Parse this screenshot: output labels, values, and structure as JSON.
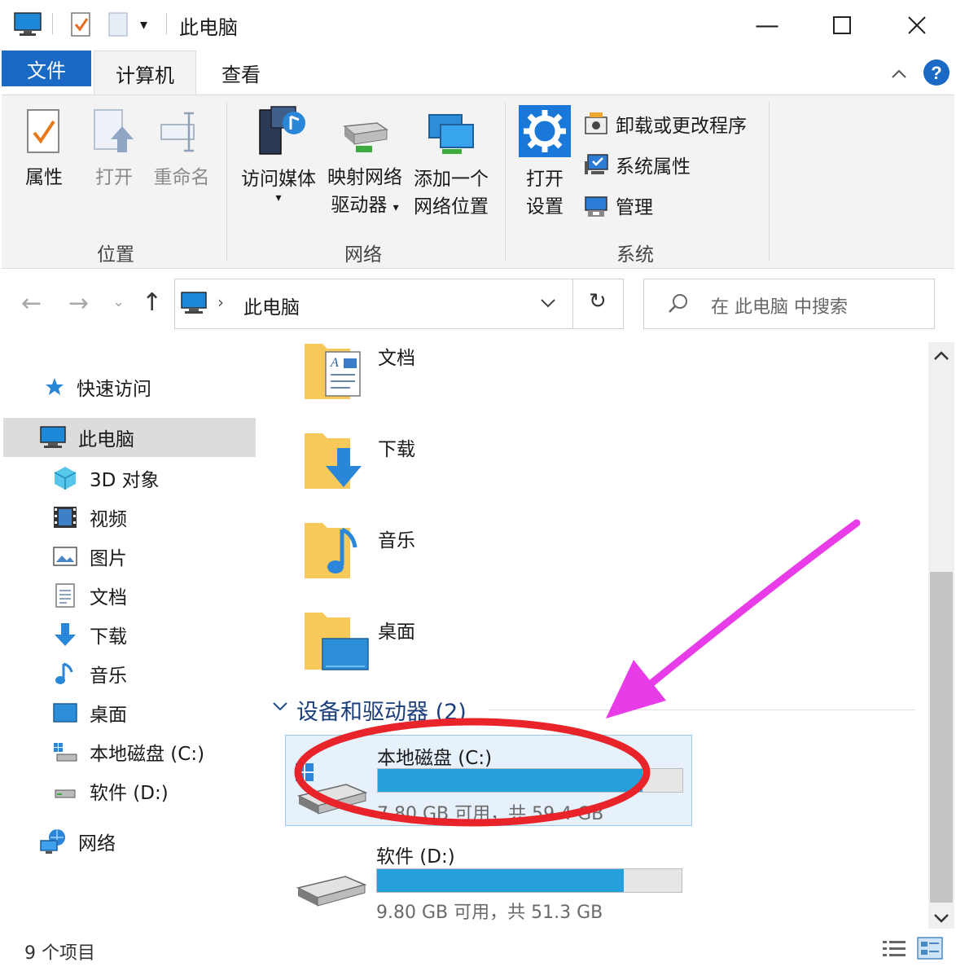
{
  "window": {
    "title": "此电脑"
  },
  "tabs": {
    "file": "文件",
    "computer": "计算机",
    "view": "查看"
  },
  "ribbon": {
    "location": {
      "label": "位置",
      "properties": "属性",
      "open": "打开",
      "rename": "重命名"
    },
    "network": {
      "label": "网络",
      "media_1": "访问媒体",
      "map_1": "映射网络",
      "map_2": "驱动器",
      "add_1": "添加一个",
      "add_2": "网络位置"
    },
    "system": {
      "label": "系统",
      "open_1": "打开",
      "open_2": "设置",
      "uninstall": "卸载或更改程序",
      "sysprops": "系统属性",
      "manage": "管理"
    }
  },
  "address": {
    "path": "此电脑",
    "search_placeholder": "在 此电脑 中搜索"
  },
  "nav": {
    "quick": "快速访问",
    "thispc": "此电脑",
    "items": [
      "3D 对象",
      "视频",
      "图片",
      "文档",
      "下载",
      "音乐",
      "桌面",
      "本地磁盘 (C:)",
      "软件 (D:)"
    ],
    "network": "网络"
  },
  "folders": [
    "文档",
    "下载",
    "音乐",
    "桌面"
  ],
  "devices": {
    "header": "设备和驱动器 (2)",
    "drives": [
      {
        "name": "本地磁盘 (C:)",
        "info": "7.80 GB 可用，共 59.4 GB",
        "used_fraction": 0.87
      },
      {
        "name": "软件 (D:)",
        "info": "9.80 GB 可用，共 51.3 GB",
        "used_fraction": 0.81
      }
    ]
  },
  "status": {
    "count": "9 个项目"
  },
  "colors": {
    "accent": "#1a69c4",
    "drive_bar": "#26a0da",
    "annotation_circle": "#e8232a",
    "annotation_arrow": "#e83ce8"
  }
}
